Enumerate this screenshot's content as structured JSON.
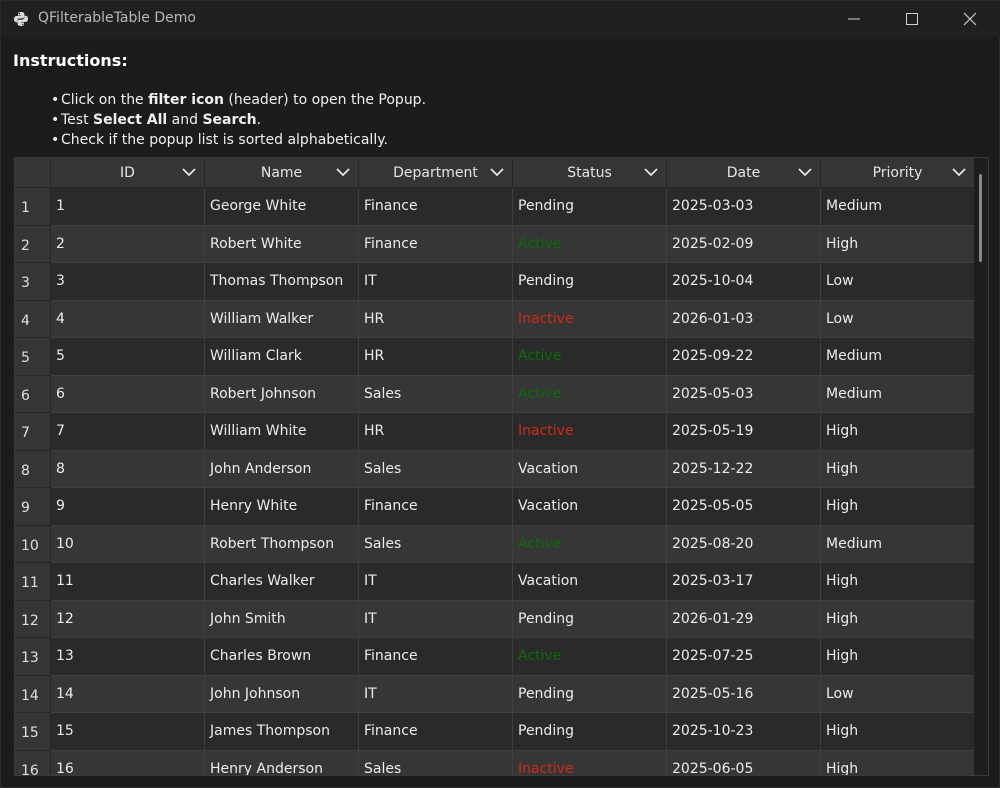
{
  "window": {
    "title": "QFilterableTable Demo",
    "icon": "python-icon"
  },
  "instructions": {
    "title": "Instructions:",
    "bullets": [
      {
        "pre": "Click on the ",
        "bold": "filter icon",
        "post": " (header) to open the Popup.",
        "bold2": "",
        "post2": ""
      },
      {
        "pre": "Test ",
        "bold": "Select All",
        "post": " and ",
        "bold2": "Search",
        "post2": "."
      },
      {
        "pre": "Check if the popup list is sorted alphabetically.",
        "bold": "",
        "post": "",
        "bold2": "",
        "post2": ""
      }
    ]
  },
  "colors": {
    "active": "#0c6b0c",
    "inactive": "#d12a1a"
  },
  "table": {
    "columns": [
      "ID",
      "Name",
      "Department",
      "Status",
      "Date",
      "Priority"
    ],
    "rows": [
      {
        "n": "1",
        "id": "1",
        "name": "George White",
        "dept": "Finance",
        "status": "Pending",
        "date": "2025-03-03",
        "priority": "Medium"
      },
      {
        "n": "2",
        "id": "2",
        "name": "Robert White",
        "dept": "Finance",
        "status": "Active",
        "date": "2025-02-09",
        "priority": "High"
      },
      {
        "n": "3",
        "id": "3",
        "name": "Thomas Thompson",
        "dept": "IT",
        "status": "Pending",
        "date": "2025-10-04",
        "priority": "Low"
      },
      {
        "n": "4",
        "id": "4",
        "name": "William Walker",
        "dept": "HR",
        "status": "Inactive",
        "date": "2026-01-03",
        "priority": "Low"
      },
      {
        "n": "5",
        "id": "5",
        "name": "William Clark",
        "dept": "HR",
        "status": "Active",
        "date": "2025-09-22",
        "priority": "Medium"
      },
      {
        "n": "6",
        "id": "6",
        "name": "Robert Johnson",
        "dept": "Sales",
        "status": "Active",
        "date": "2025-05-03",
        "priority": "Medium"
      },
      {
        "n": "7",
        "id": "7",
        "name": "William White",
        "dept": "HR",
        "status": "Inactive",
        "date": "2025-05-19",
        "priority": "High"
      },
      {
        "n": "8",
        "id": "8",
        "name": "John Anderson",
        "dept": "Sales",
        "status": "Vacation",
        "date": "2025-12-22",
        "priority": "High"
      },
      {
        "n": "9",
        "id": "9",
        "name": "Henry White",
        "dept": "Finance",
        "status": "Vacation",
        "date": "2025-05-05",
        "priority": "High"
      },
      {
        "n": "10",
        "id": "10",
        "name": "Robert Thompson",
        "dept": "Sales",
        "status": "Active",
        "date": "2025-08-20",
        "priority": "Medium"
      },
      {
        "n": "11",
        "id": "11",
        "name": "Charles Walker",
        "dept": "IT",
        "status": "Vacation",
        "date": "2025-03-17",
        "priority": "High"
      },
      {
        "n": "12",
        "id": "12",
        "name": "John Smith",
        "dept": "IT",
        "status": "Pending",
        "date": "2026-01-29",
        "priority": "High"
      },
      {
        "n": "13",
        "id": "13",
        "name": "Charles Brown",
        "dept": "Finance",
        "status": "Active",
        "date": "2025-07-25",
        "priority": "High"
      },
      {
        "n": "14",
        "id": "14",
        "name": "John Johnson",
        "dept": "IT",
        "status": "Pending",
        "date": "2025-05-16",
        "priority": "Low"
      },
      {
        "n": "15",
        "id": "15",
        "name": "James Thompson",
        "dept": "Finance",
        "status": "Pending",
        "date": "2025-10-23",
        "priority": "High"
      },
      {
        "n": "16",
        "id": "16",
        "name": "Henry Anderson",
        "dept": "Sales",
        "status": "Inactive",
        "date": "2025-06-05",
        "priority": "High"
      }
    ]
  }
}
